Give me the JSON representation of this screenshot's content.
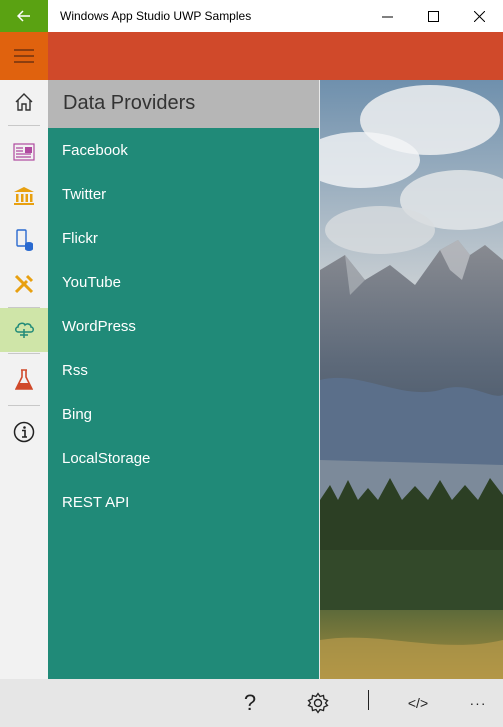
{
  "window": {
    "title": "Windows App Studio UWP Samples"
  },
  "panel": {
    "title": "Data Providers",
    "items": [
      {
        "label": "Facebook"
      },
      {
        "label": "Twitter"
      },
      {
        "label": "Flickr"
      },
      {
        "label": "YouTube"
      },
      {
        "label": "WordPress"
      },
      {
        "label": "Rss"
      },
      {
        "label": "Bing"
      },
      {
        "label": "LocalStorage"
      },
      {
        "label": "REST API"
      }
    ]
  },
  "rail": {
    "items": [
      {
        "icon": "home-icon"
      },
      {
        "icon": "layout-icon"
      },
      {
        "icon": "bank-icon"
      },
      {
        "icon": "device-storage-icon"
      },
      {
        "icon": "tools-icon"
      },
      {
        "icon": "cloud-data-icon",
        "active": true
      },
      {
        "icon": "flask-icon"
      },
      {
        "icon": "info-icon"
      }
    ]
  },
  "appbar": {
    "help_label": "?",
    "code_label": "</>",
    "more_label": "···"
  },
  "colors": {
    "titlebar_back": "#5aa212",
    "header": "#d0492a",
    "hamburger": "#e0620e",
    "panel": "#208a78",
    "panel_header": "#b6b6b6",
    "rail_active": "#cfe5a8"
  }
}
